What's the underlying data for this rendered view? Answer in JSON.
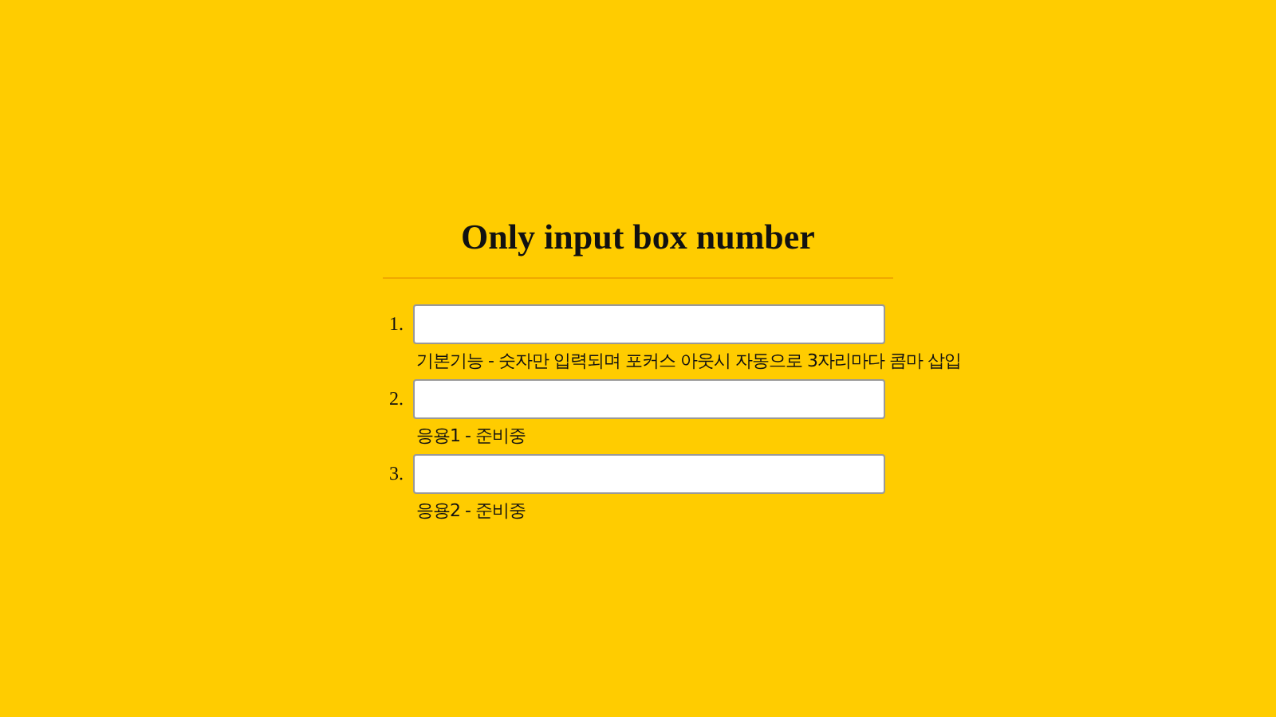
{
  "title": "Only input box number",
  "items": [
    {
      "number": "1.",
      "hint": "기본기능 - 숫자만 입력되며 포커스 아웃시 자동으로 3자리마다 콤마 삽입"
    },
    {
      "number": "2.",
      "hint": "응용1 - 준비중"
    },
    {
      "number": "3.",
      "hint": "응용2 - 준비중"
    }
  ]
}
